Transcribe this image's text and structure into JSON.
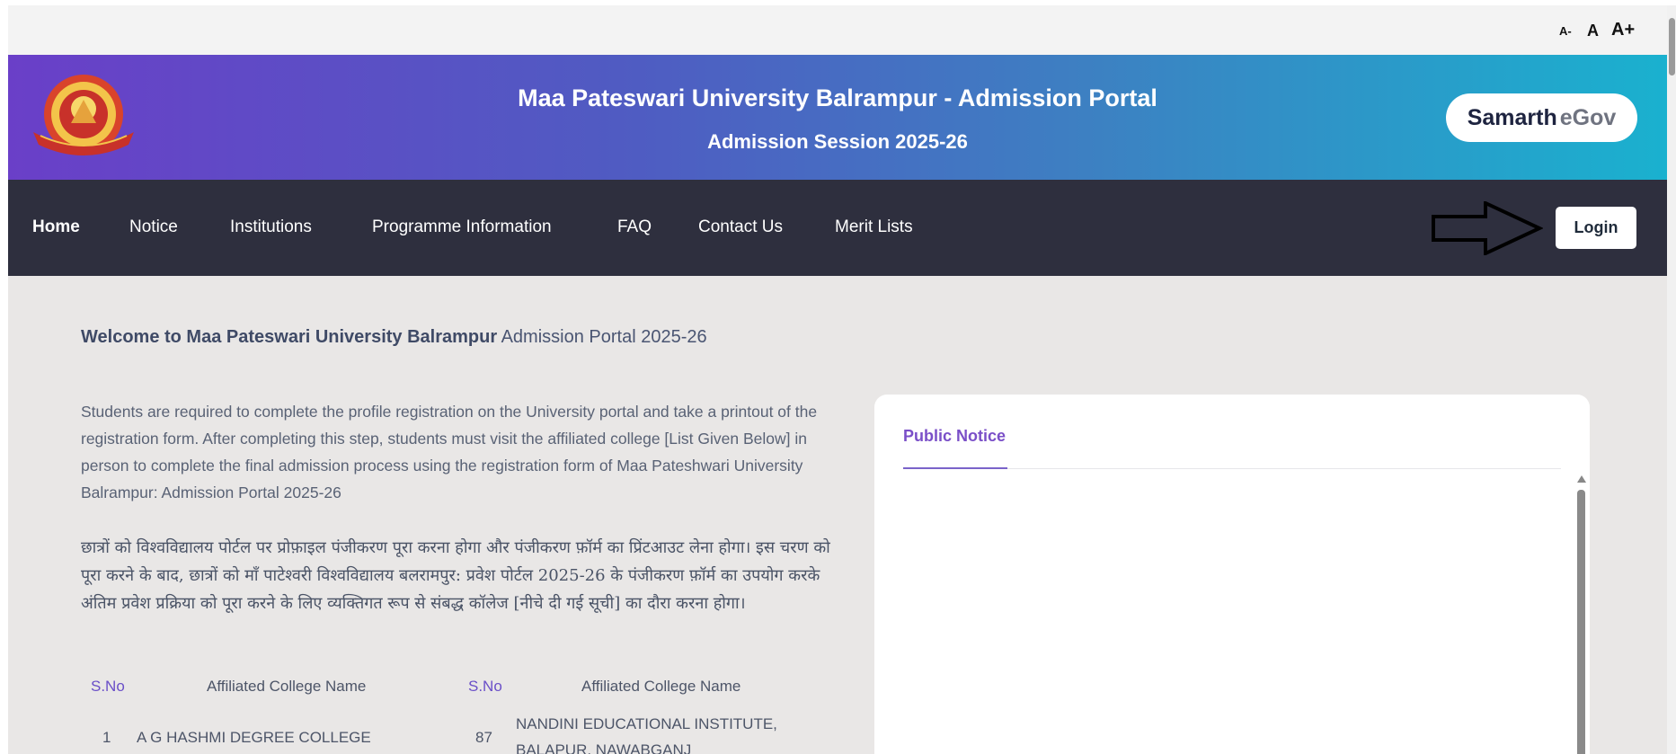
{
  "font_controls": {
    "decrease": "A-",
    "normal": "A",
    "increase": "A+"
  },
  "header": {
    "title": "Maa Pateswari University Balrampur - Admission Portal",
    "subtitle": "Admission Session 2025-26",
    "brand_part1": "Samarth",
    "brand_part2": "eGov"
  },
  "nav": {
    "items": [
      "Home",
      "Notice",
      "Institutions",
      "Programme Information",
      "FAQ",
      "Contact Us",
      "Merit Lists"
    ],
    "login": "Login"
  },
  "main": {
    "welcome_bold": "Welcome to Maa Pateswari University Balrampur",
    "welcome_rest": " Admission Portal 2025-26",
    "intro_en": "Students are required to complete the profile registration on the University portal and take a printout of the registration form. After completing this step, students must visit the affiliated college [List Given Below] in person to complete the final admission process using the registration form of Maa Pateshwari University Balrampur: Admission Portal 2025-26",
    "intro_hi": "छात्रों को विश्वविद्यालय पोर्टल पर प्रोफ़ाइल पंजीकरण पूरा करना होगा और पंजीकरण फ़ॉर्म का प्रिंटआउट लेना होगा। इस चरण को पूरा करने के बाद, छात्रों को माँ पाटेश्वरी विश्वविद्यालय बलरामपुर: प्रवेश पोर्टल 2025-26 के पंजीकरण फ़ॉर्म का उपयोग करके अंतिम प्रवेश प्रक्रिया को पूरा करने के लिए व्यक्तिगत रूप से संबद्ध कॉलेज [नीचे दी गई सूची] का दौरा करना होगा।",
    "table": {
      "headers": [
        "S.No",
        "Affiliated College Name",
        "S.No",
        "Affiliated College Name"
      ],
      "row1": {
        "sno1": "1",
        "name1": "A G HASHMI DEGREE COLLEGE",
        "sno2": "87",
        "name2_line1": "NANDINI EDUCATIONAL INSTITUTE,",
        "name2_line2": "BALAPUR, NAWABGANJ"
      }
    }
  },
  "notice": {
    "title": "Public Notice"
  },
  "colors": {
    "accent": "#7a4fc8",
    "nav_bg": "#2e2f3e",
    "header_start": "#6a3fc8",
    "header_end": "#1ab1cf"
  }
}
